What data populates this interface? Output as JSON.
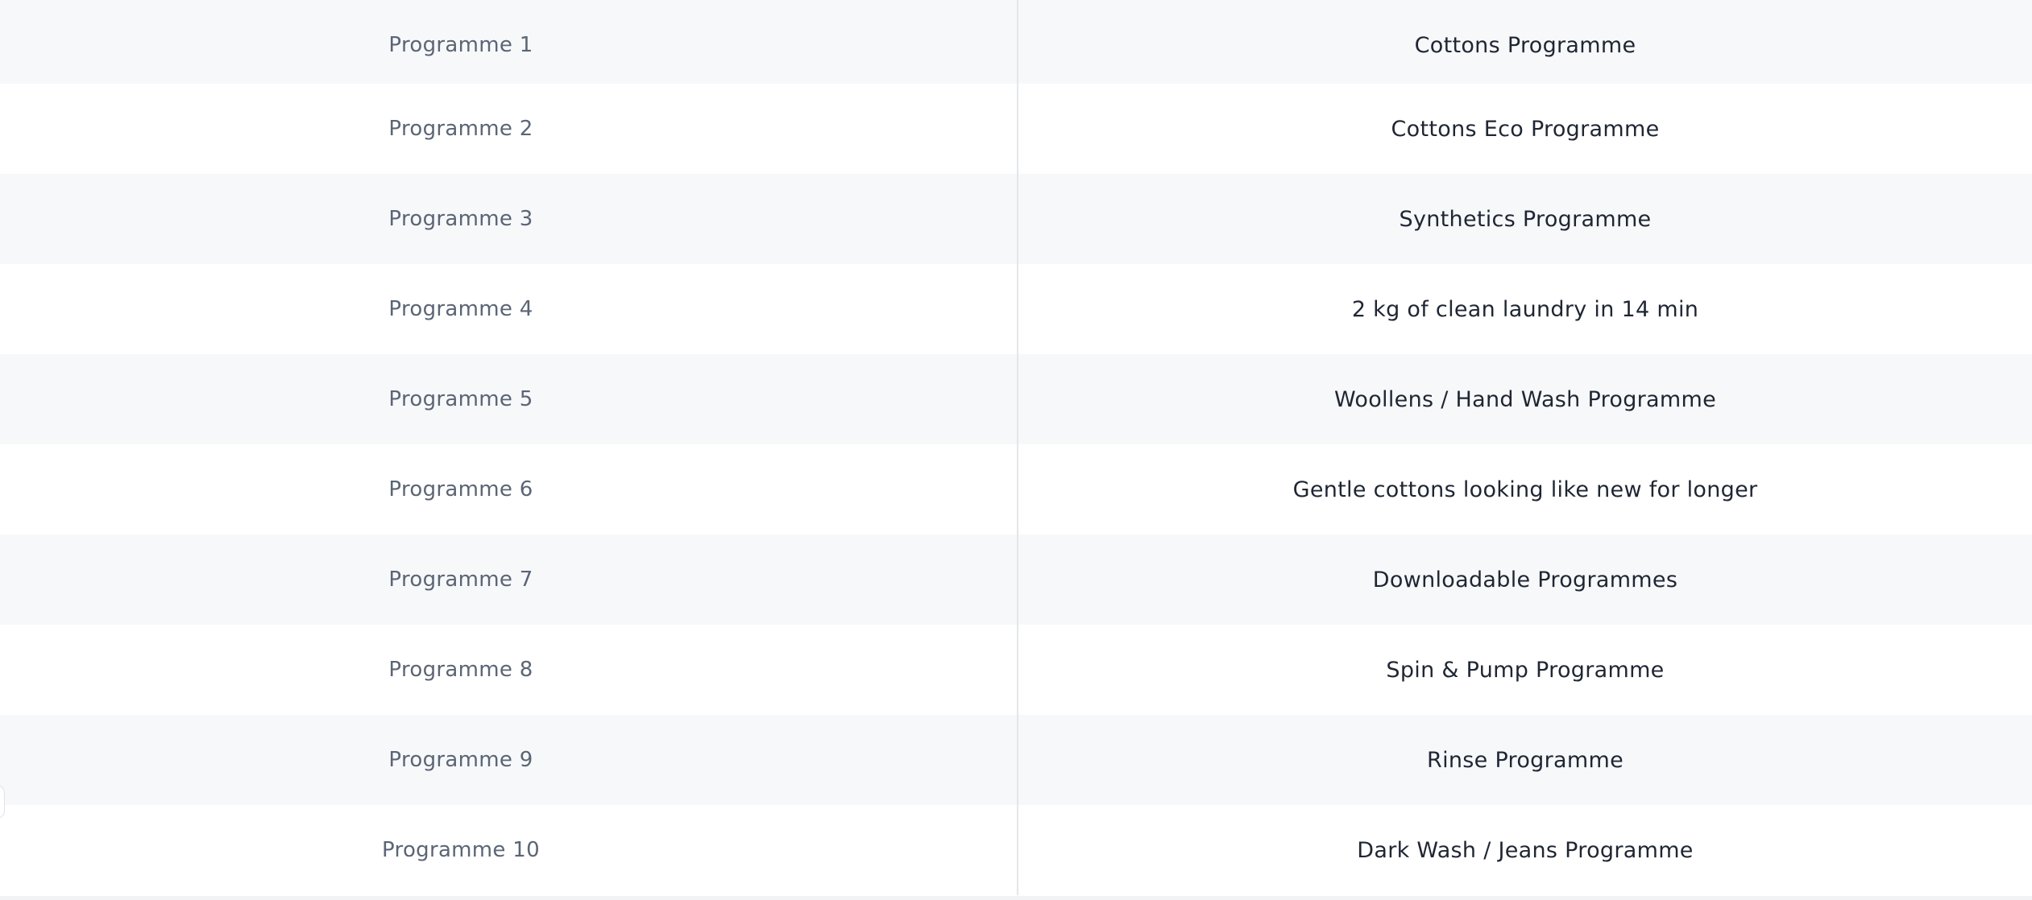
{
  "table": {
    "rows": [
      {
        "label": "Programme 1",
        "value": "Cottons Programme"
      },
      {
        "label": "Programme 2",
        "value": "Cottons Eco Programme"
      },
      {
        "label": "Programme 3",
        "value": "Synthetics Programme"
      },
      {
        "label": "Programme 4",
        "value": "2 kg of clean laundry in 14 min"
      },
      {
        "label": "Programme 5",
        "value": "Woollens / Hand Wash Programme"
      },
      {
        "label": "Programme 6",
        "value": "Gentle cottons looking like new for longer"
      },
      {
        "label": "Programme 7",
        "value": "Downloadable Programmes"
      },
      {
        "label": "Programme 8",
        "value": "Spin & Pump Programme"
      },
      {
        "label": "Programme 9",
        "value": "Rinse Programme"
      },
      {
        "label": "Programme 10",
        "value": "Dark Wash / Jeans Programme"
      }
    ]
  },
  "colors": {
    "row_alt": "#f7f8fa",
    "label_text": "#5b6575",
    "value_text": "#1f2633",
    "divider": "#e3e6ea"
  }
}
